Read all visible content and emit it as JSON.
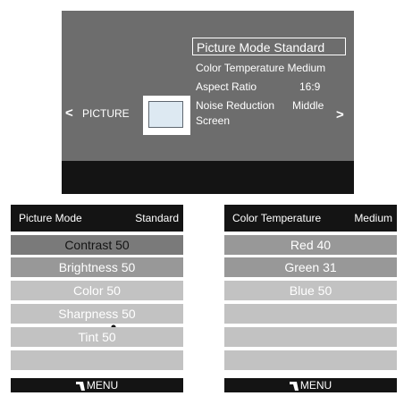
{
  "top_menu": {
    "title": "PICTURE",
    "options": [
      {
        "label": "Picture Mode Standard"
      },
      {
        "label": "Color Temperature Medium"
      },
      {
        "label": "Aspect Ratio",
        "value": "16:9"
      },
      {
        "label": "Noise Reduction",
        "value": "Middle"
      },
      {
        "label": "Screen"
      }
    ],
    "left_arrow": "<",
    "right_arrow": ">",
    "icons": [
      "gear-icon",
      "monitor-icon",
      "music-icon",
      "clock-icon",
      "grid-icon",
      "lock-icon"
    ]
  },
  "picture_panel": {
    "header_label": "Picture Mode",
    "header_value": "Standard",
    "rows": [
      "Contrast 50",
      "Brightness 50",
      "Color 50",
      "Sharpness 50",
      "Tint 50",
      ""
    ],
    "footer": "MENU"
  },
  "color_panel": {
    "header_label": "Color Temperature",
    "header_value": "Medium",
    "rows": [
      "Red 40",
      "Green 31",
      "Blue 50",
      "",
      "",
      ""
    ],
    "footer": "MENU"
  },
  "colors": {
    "panel_bg": "#6d6d6d",
    "bar_bg": "#141414",
    "row_dark": "#7a7a7a",
    "row_mid": "#989898",
    "row_light": "#c2c2c2"
  }
}
